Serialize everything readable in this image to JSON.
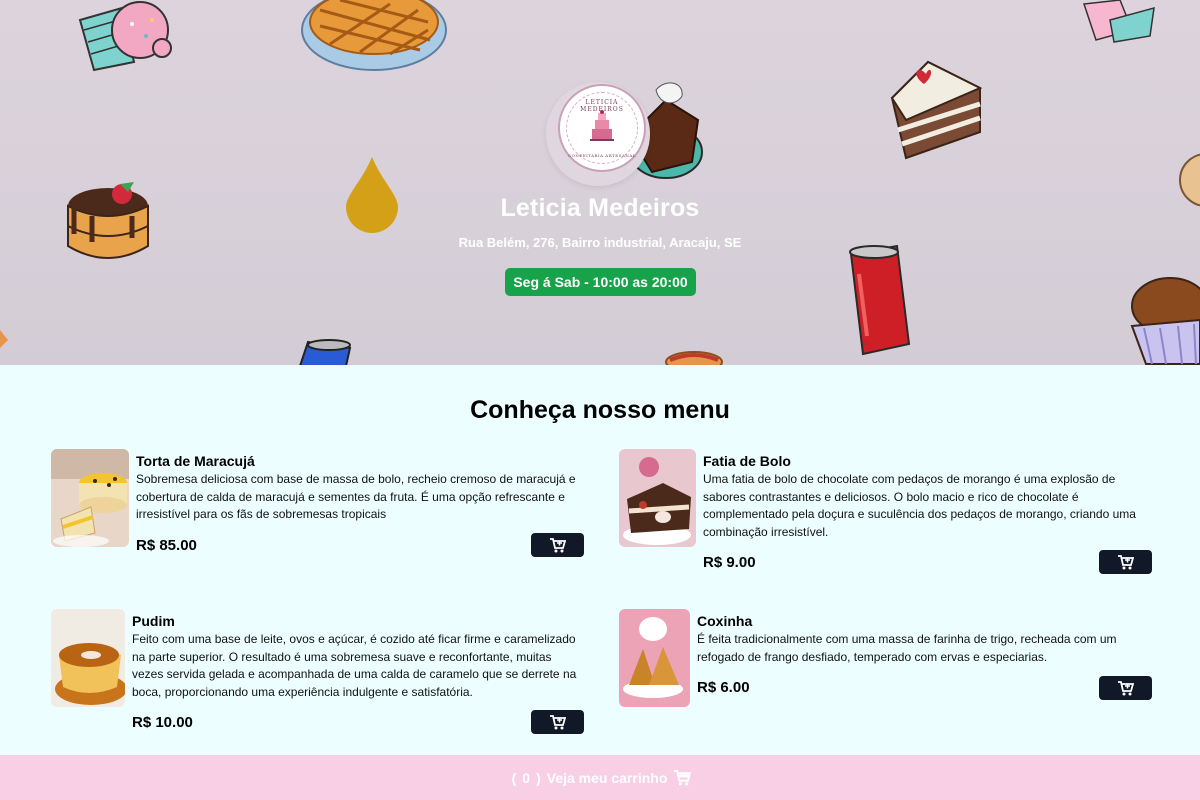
{
  "header": {
    "logo_text_top": "LETICIA MEDEIROS",
    "logo_text_bottom": "CONFEITARIA ARTESANAL",
    "title": "Leticia Medeiros",
    "address": "Rua Belém, 276, Bairro industrial, Aracaju, SE",
    "hours": "Seg á Sab - 10:00 as 20:00",
    "hours_color": "#16a34a"
  },
  "menu": {
    "title": "Conheça nosso menu",
    "items": [
      {
        "name": "Torta de Maracujá",
        "description": "Sobremesa deliciosa com base de massa de bolo, recheio cremoso de maracujá e cobertura de calda de maracujá e sementes da fruta. É uma opção refrescante e irresistível para os fãs de sobremesas tropicais",
        "price": "R$ 85.00",
        "icon": "cart-plus-icon"
      },
      {
        "name": "Fatia de Bolo",
        "description": "Uma fatia de bolo de chocolate com pedaços de morango é uma explosão de sabores contrastantes e deliciosos. O bolo macio e rico de chocolate é complementado pela doçura e suculência dos pedaços de morango, criando uma combinação irresistível.",
        "price": "R$ 9.00",
        "icon": "cart-plus-icon"
      },
      {
        "name": "Pudim",
        "description": "Feito com uma base de leite, ovos e açúcar, é cozido até ficar firme e caramelizado na parte superior. O resultado é uma sobremesa suave e reconfortante, muitas vezes servida gelada e acompanhada de uma calda de caramelo que se derrete na boca, proporcionando uma experiência indulgente e satisfatória.",
        "price": "R$ 10.00",
        "icon": "cart-plus-icon"
      },
      {
        "name": "Coxinha",
        "description": "É feita tradicionalmente com uma massa de farinha de trigo, recheada com um refogado de frango desfiado, temperado com ervas e especiarias.",
        "price": "R$ 6.00",
        "icon": "cart-plus-icon"
      }
    ]
  },
  "footer": {
    "open_paren": "(",
    "count": "0",
    "close_paren": ")",
    "label": "Veja meu carrinho",
    "icon": "cart-icon",
    "color": "#f9cfe6"
  }
}
